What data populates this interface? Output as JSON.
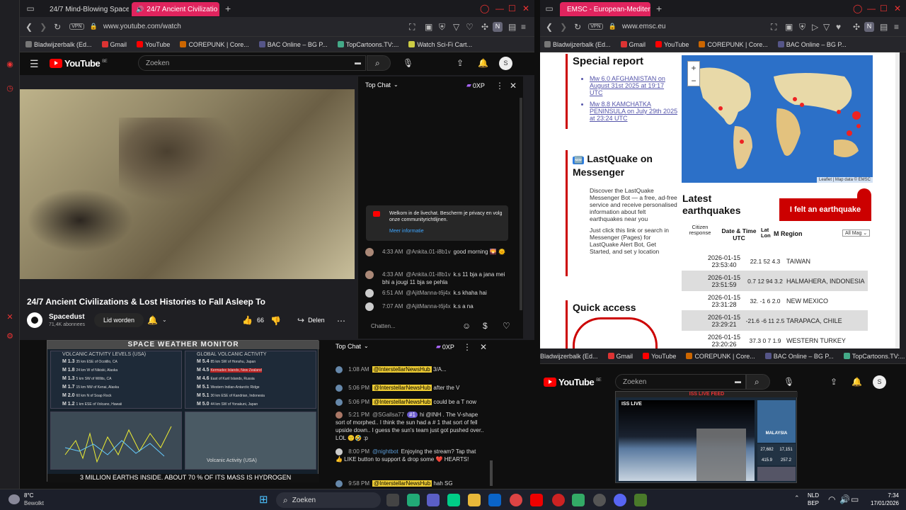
{
  "left_window": {
    "tabs": [
      {
        "label": "24/7 Mind-Blowing Space"
      },
      {
        "label": "24/7 Ancient Civilizatio",
        "active": true
      }
    ],
    "url": "www.youtube.com/watch",
    "vpn": "VPN",
    "bookmarks": [
      "Bladwijzerbalk (Ed...",
      "Gmail",
      "YouTube",
      "COREPUNK | Core...",
      "BAC Online – BG P...",
      "TopCartoons.TV:...",
      "Watch Sci-Fi Cart..."
    ],
    "youtube": {
      "logo": "YouTube",
      "region": "BE",
      "search_placeholder": "Zoeken",
      "avatar_letter": "S",
      "video_title": "24/7 Ancient Civilizations & Lost Histories to Fall Asleep To",
      "channel": "Spacedust",
      "subscribers": "71,4K abonnees",
      "join_label": "Lid worden",
      "likes": "66",
      "share_label": "Delen",
      "chat": {
        "header": "Top Chat",
        "xp": "0XP",
        "welcome": "Welkom in de livechat. Bescherm je privacy en volg onze communityrichtlijnen.",
        "more_info": "Meer informatie",
        "messages": [
          {
            "time": "4:33 AM",
            "author": "@Ankita.01-i8b1v",
            "text": "good morning 🌄 🌞"
          },
          {
            "time": "4:33 AM",
            "author": "@Ankita.01-i8b1v",
            "text": "k.s 11 bja a jana mei bhi a jougi 11 bja se pehla"
          },
          {
            "time": "6:51 AM",
            "author": "@AjitManna-t6j4x",
            "text": "k.s khaha hai"
          },
          {
            "time": "7:07 AM",
            "author": "@AjitManna-t6j4x",
            "text": "k.s a na"
          }
        ],
        "input_placeholder": "Chatten..."
      }
    }
  },
  "right_window": {
    "tab": "EMSC - European-Mediter",
    "url": "www.emsc.eu",
    "vpn": "VPN",
    "bookmarks": [
      "Bladwijzerbalk (Ed...",
      "Gmail",
      "YouTube",
      "COREPUNK | Core...",
      "BAC Online – BG P..."
    ],
    "special_report": {
      "title": "Special report",
      "links": [
        "Mw 6.0 AFGHANISTAN on August 31st 2025 at 19:17 UTC",
        "Mw 8.8 KAMCHATKA PENINSULA on July 29th 2025 at 23:24 UTC"
      ]
    },
    "map": {
      "attribution": "Leaflet | Map data © EMSC",
      "zoom_in": "+",
      "zoom_out": "−"
    },
    "lastquake": {
      "badge": "🆕",
      "title": "LastQuake on Messenger",
      "bullets": [
        "Discover the LastQuake Messenger Bot — a free, ad-free service and receive personalised information about felt earthquakes near you",
        "Just click this link or search in Messenger (Pages) for LastQuake Alert Bot, Get Started, and set y location"
      ]
    },
    "latest": {
      "title": "Latest earthquakes",
      "felt_button": "I felt an earthquake",
      "columns": {
        "citizen": "Citizen response",
        "datetime": "Date & Time UTC",
        "latlon": "Lat Lon",
        "mag": "M",
        "region": "Region",
        "filter": "All Mag"
      },
      "rows": [
        {
          "date": "2026-01-15",
          "time": "23:53:40",
          "lat": "22.1",
          "lon": "52",
          "mag": "4.3",
          "region": "TAIWAN"
        },
        {
          "date": "2026-01-15",
          "time": "23:51:59",
          "lat": "0.7",
          "lon": "12 94",
          "mag": "3.2",
          "region": "HALMAHERA, INDONESIA"
        },
        {
          "date": "2026-01-15",
          "time": "23:31:28",
          "lat": "32.",
          "lon": "-1 6",
          "mag": "2.0",
          "region": "NEW MEXICO"
        },
        {
          "date": "2026-01-15",
          "time": "23:29:21",
          "lat": "-21.6",
          "lon": "-6 11",
          "mag": "2.5",
          "region": "TARAPACA, CHILE"
        },
        {
          "date": "2026-01-15",
          "time": "23:20:26",
          "lat": "37.3",
          "lon": "0 7",
          "mag": "1.9",
          "region": "WESTERN TURKEY"
        }
      ]
    },
    "quick_access": "Quick access"
  },
  "bottom_left": {
    "monitor_title": "SPACE WEATHER MONITOR",
    "volcanic_left": "VOLCANIC ACTIVITY LEVELS (USA)",
    "volcanic_right": "GLOBAL VOLCANIC ACTIVITY",
    "quakes_left": [
      {
        "mag": "M 1.3",
        "loc": "35 km ESE of Ocotillo, CA"
      },
      {
        "mag": "M 1.8",
        "loc": "24 km W of Nikiski, Alaska"
      },
      {
        "mag": "M 1.3",
        "loc": "5 km SW of Willits, CA"
      },
      {
        "mag": "M 1.7",
        "loc": "15 km NW of Kenai, Alaska"
      },
      {
        "mag": "M 2.0",
        "loc": "60 km N of Soap Rock"
      },
      {
        "mag": "M 1.2",
        "loc": "1 km ESE of Volcano, Hawaii"
      }
    ],
    "quakes_right": [
      {
        "mag": "M 5.4",
        "loc": "85 km SW of Honshu, Japan"
      },
      {
        "mag": "M 4.5",
        "loc": "Kermadec Islands, New Zealand"
      },
      {
        "mag": "M 4.6",
        "loc": "East of Kuril Islands, Russia"
      },
      {
        "mag": "M 5.1",
        "loc": "Western Indian-Antarctic Ridge"
      },
      {
        "mag": "M 5.1",
        "loc": "30 km ESE of Kandrian, Indonesia"
      },
      {
        "mag": "M 5.0",
        "loc": "44 km SW of Yonakuni, Japan"
      }
    ],
    "usa_label": "Volcanic Activity (USA)",
    "ticker": "3 MILLION EARTHS INSIDE.   ABOUT 70 % OF ITS MASS IS HYDROGEN",
    "chat": {
      "header": "Top Chat",
      "xp": "0XP",
      "messages": [
        {
          "time": "1:08 AM",
          "author": "@InterstellarNewsHub",
          "text": "3/A..."
        },
        {
          "time": "5:06 PM",
          "author": "@InterstellarNewsHub",
          "text": "after the V"
        },
        {
          "time": "5:06 PM",
          "author": "@InterstellarNewsHub",
          "text": "could be a T now"
        },
        {
          "time": "5:21 PM",
          "author": "@SGallsa77",
          "badge": "#1",
          "text": "hi @INH . The V-shape sort of morphed.. I think the sun had a # 1 that sort of fell upside down.. I guess the sun's team just got pushed over.. LOL 🙂🤣 :p"
        },
        {
          "time": "8:00 PM",
          "author": "@nightbot",
          "text": "Enjoying the stream? Tap that 👍 LIKE button to support & drop some ❤️ HEARTS!"
        },
        {
          "time": "9:58 PM",
          "author": "@InterstellarNewsHub",
          "text": "hah SG"
        }
      ]
    }
  },
  "bottom_right": {
    "bookmarks": [
      "Bladwijzerbalk (Ed...",
      "Gmail",
      "YouTube",
      "COREPUNK | Core...",
      "BAC Online – BG P...",
      "TopCartoons.TV:..."
    ],
    "youtube_logo": "YouTube",
    "region": "BE",
    "search_placeholder": "Zoeken",
    "avatar_letter": "S",
    "iss_title": "ISS LIVE FEED",
    "iss_live": "ISS LIVE",
    "iss_location": "MALAYSIA",
    "iss_stats": [
      "27,682",
      "17,151",
      "415.9",
      "257.2"
    ]
  },
  "taskbar": {
    "temp": "8°C",
    "weather": "Bewolkt",
    "search": "Zoeken",
    "lang": "NLD",
    "lang2": "BEP",
    "time": "7:34",
    "date": "17/01/2026"
  },
  "colors": {
    "accent_pink": "#e0245e",
    "yt_red": "#ff0000",
    "emsc_red": "#c00000"
  }
}
